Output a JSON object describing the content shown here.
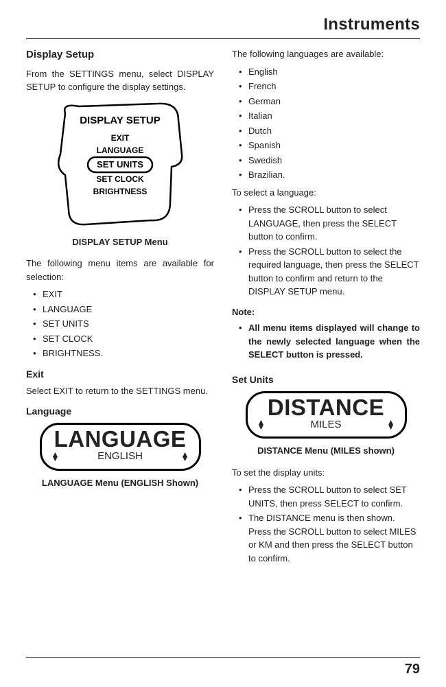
{
  "header": {
    "title": "Instruments"
  },
  "page_number": "79",
  "left": {
    "h_display_setup": "Display Setup",
    "intro": "From the SETTINGS menu, select DISPLAY SETUP to configure the display settings.",
    "figure": {
      "title": "DISPLAY SETUP",
      "items": [
        "EXIT",
        "LANGUAGE",
        "SET UNITS",
        "SET CLOCK",
        "BRIGHTNESS"
      ]
    },
    "caption_setup": "DISPLAY SETUP Menu",
    "menu_intro": "The following menu items are available for selection:",
    "menu_items": [
      "EXIT",
      "LANGUAGE",
      "SET UNITS",
      "SET CLOCK",
      "BRIGHTNESS."
    ],
    "h_exit": "Exit",
    "exit_p": "Select EXIT to return to the SETTINGS menu.",
    "h_language": "Language",
    "lang_pill": {
      "big": "LANGUAGE",
      "small": "ENGLISH"
    },
    "caption_lang": "LANGUAGE Menu (ENGLISH Shown)"
  },
  "right": {
    "lang_intro": "The following languages are available:",
    "languages": [
      "English",
      "French",
      "German",
      "Italian",
      "Dutch",
      "Spanish",
      "Swedish",
      "Brazilian."
    ],
    "select_intro": "To select a language:",
    "select_steps": [
      "Press the SCROLL button to select LANGUAGE, then press the SELECT button to confirm.",
      "Press the SCROLL button to select the required language, then press the SELECT button to confirm and return to the DISPLAY SETUP menu."
    ],
    "note_head": "Note:",
    "note_item": "All menu items displayed will change to the newly selected language when the SELECT button is pressed.",
    "h_set_units": "Set Units",
    "dist_pill": {
      "big": "DISTANCE",
      "small": "MILES"
    },
    "caption_dist": "DISTANCE Menu (MILES shown)",
    "units_intro": "To set the display units:",
    "units_steps": [
      "Press the SCROLL button to select SET UNITS, then press SELECT to confirm.",
      "The DISTANCE menu is then shown. Press the SCROLL button to select MILES or KM and then press the SELECT button to confirm."
    ]
  }
}
